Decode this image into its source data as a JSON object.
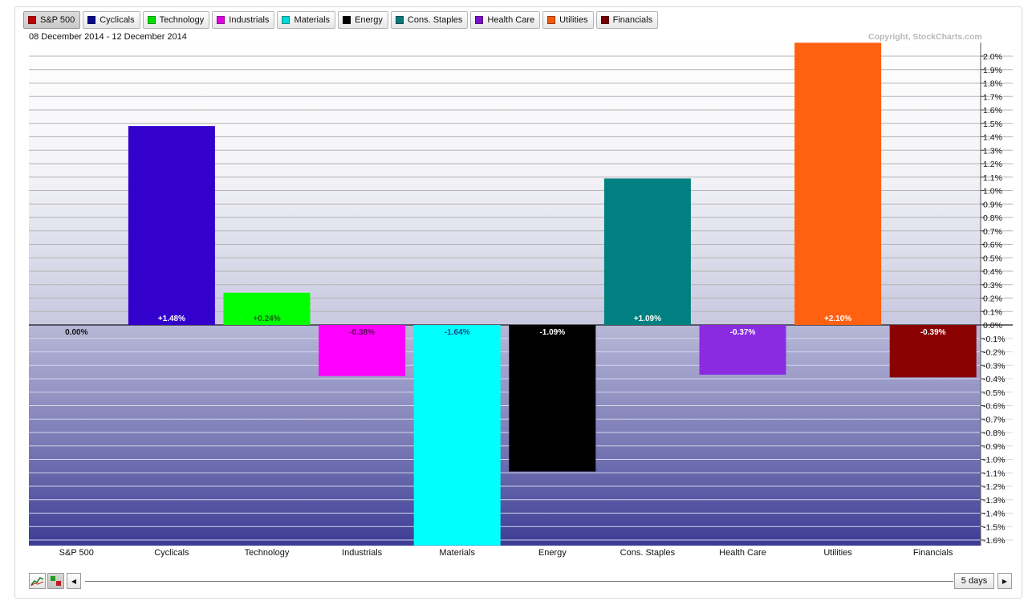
{
  "legend": {
    "items": [
      {
        "label": "S&P 500",
        "color": "#c00000",
        "active": true
      },
      {
        "label": "Cyclicals",
        "color": "#0a0a8c"
      },
      {
        "label": "Technology",
        "color": "#00e000"
      },
      {
        "label": "Industrials",
        "color": "#e000e0"
      },
      {
        "label": "Materials",
        "color": "#00d8d8"
      },
      {
        "label": "Energy",
        "color": "#000000"
      },
      {
        "label": "Cons. Staples",
        "color": "#0a7a7a"
      },
      {
        "label": "Health Care",
        "color": "#7a10c8"
      },
      {
        "label": "Utilities",
        "color": "#f05a0a"
      },
      {
        "label": "Financials",
        "color": "#7a0000"
      }
    ]
  },
  "header": {
    "date_range": "08 December 2014 - 12 December 2014",
    "copyright": "Copyright, StockCharts.com"
  },
  "chart_data": {
    "type": "bar",
    "categories": [
      "S&P 500",
      "Cyclicals",
      "Technology",
      "Industrials",
      "Materials",
      "Energy",
      "Cons. Staples",
      "Health Care",
      "Utilities",
      "Financials"
    ],
    "values": [
      0.0,
      1.48,
      0.24,
      -0.38,
      -1.64,
      -1.09,
      1.09,
      -0.37,
      2.1,
      -0.39
    ],
    "value_labels": [
      "0.00%",
      "+1.48%",
      "+0.24%",
      "-0.38%",
      "-1.64%",
      "-1.09%",
      "+1.09%",
      "-0.37%",
      "+2.10%",
      "-0.39%"
    ],
    "colors": [
      "#c00000",
      "#3300cc",
      "#00ff00",
      "#ff00ff",
      "#00ffff",
      "#000000",
      "#008080",
      "#8a2be2",
      "#ff6111",
      "#8b0000"
    ],
    "ylim": [
      -1.65,
      2.1
    ],
    "yticks": [
      "2.0%",
      "1.9%",
      "1.8%",
      "1.7%",
      "1.6%",
      "1.5%",
      "1.4%",
      "1.3%",
      "1.2%",
      "1.1%",
      "1.0%",
      "0.9%",
      "0.8%",
      "0.7%",
      "0.6%",
      "0.5%",
      "0.4%",
      "0.3%",
      "0.2%",
      "0.1%",
      "0.0%",
      "-0.1%",
      "-0.2%",
      "-0.3%",
      "-0.4%",
      "-0.5%",
      "-0.6%",
      "-0.7%",
      "-0.8%",
      "-0.9%",
      "-1.0%",
      "-1.1%",
      "-1.2%",
      "-1.3%",
      "-1.4%",
      "-1.5%",
      "-1.6%"
    ],
    "ytick_values": [
      2.0,
      1.9,
      1.8,
      1.7,
      1.6,
      1.5,
      1.4,
      1.3,
      1.2,
      1.1,
      1.0,
      0.9,
      0.8,
      0.7,
      0.6,
      0.5,
      0.4,
      0.3,
      0.2,
      0.1,
      0.0,
      -0.1,
      -0.2,
      -0.3,
      -0.4,
      -0.5,
      -0.6,
      -0.7,
      -0.8,
      -0.9,
      -1.0,
      -1.1,
      -1.2,
      -1.3,
      -1.4,
      -1.5,
      -1.6
    ],
    "grid": true,
    "y_axis_position": "right"
  },
  "controls": {
    "period_label": "5 days",
    "prev_icon": "◀",
    "next_icon": "▶"
  }
}
